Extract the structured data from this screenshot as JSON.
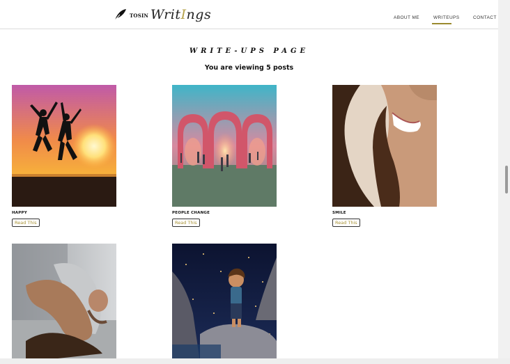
{
  "header": {
    "logo_small": "TOSIN",
    "logo_script_a": "Writ",
    "logo_script_accent": "I",
    "logo_script_b": "ngs",
    "nav": [
      {
        "label": "ABOUT ME"
      },
      {
        "label": "WRITEUPS",
        "active": true
      },
      {
        "label": "CONTACT"
      }
    ]
  },
  "main": {
    "title": "WRITE-UPS PAGE",
    "subtitle": "You are viewing 5 posts",
    "posts": [
      {
        "title": "HAPPY",
        "button": "Read This"
      },
      {
        "title": "PEOPLE CHANGE",
        "button": "Read This"
      },
      {
        "title": "SMILE",
        "button": "Read This"
      },
      {
        "title": "",
        "button": ""
      },
      {
        "title": "",
        "button": ""
      }
    ]
  },
  "colors": {
    "accent": "#9a8a2e",
    "button_text": "#a89235"
  }
}
